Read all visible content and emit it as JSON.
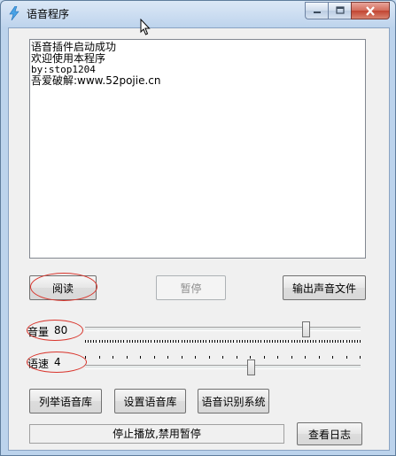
{
  "window": {
    "title": "语音程序",
    "icon": "lightning-app-icon"
  },
  "caption_buttons": [
    "minimize-icon",
    "maximize-icon",
    "close-icon"
  ],
  "log": {
    "lines": [
      "语音插件启动成功",
      "欢迎使用本程序",
      "by:stop1204",
      "吾爱破解:www.52pojie.cn"
    ]
  },
  "buttons": {
    "read": "阅读",
    "pause": "暂停",
    "export": "输出声音文件",
    "list_voices": "列举语音库",
    "set_voice": "设置语音库",
    "speech_recognition": "语音识别系统",
    "view_log": "查看日志"
  },
  "volume": {
    "label": "音量",
    "value": "80",
    "level": 0.8
  },
  "speed": {
    "label": "语速",
    "value": "4",
    "level": 0.6,
    "range": [
      -10,
      10
    ]
  },
  "status": {
    "text": "停止播放,禁用暂停"
  },
  "colors": {
    "highlight": "#d9342b",
    "title_bar": "#c6d9ef"
  }
}
